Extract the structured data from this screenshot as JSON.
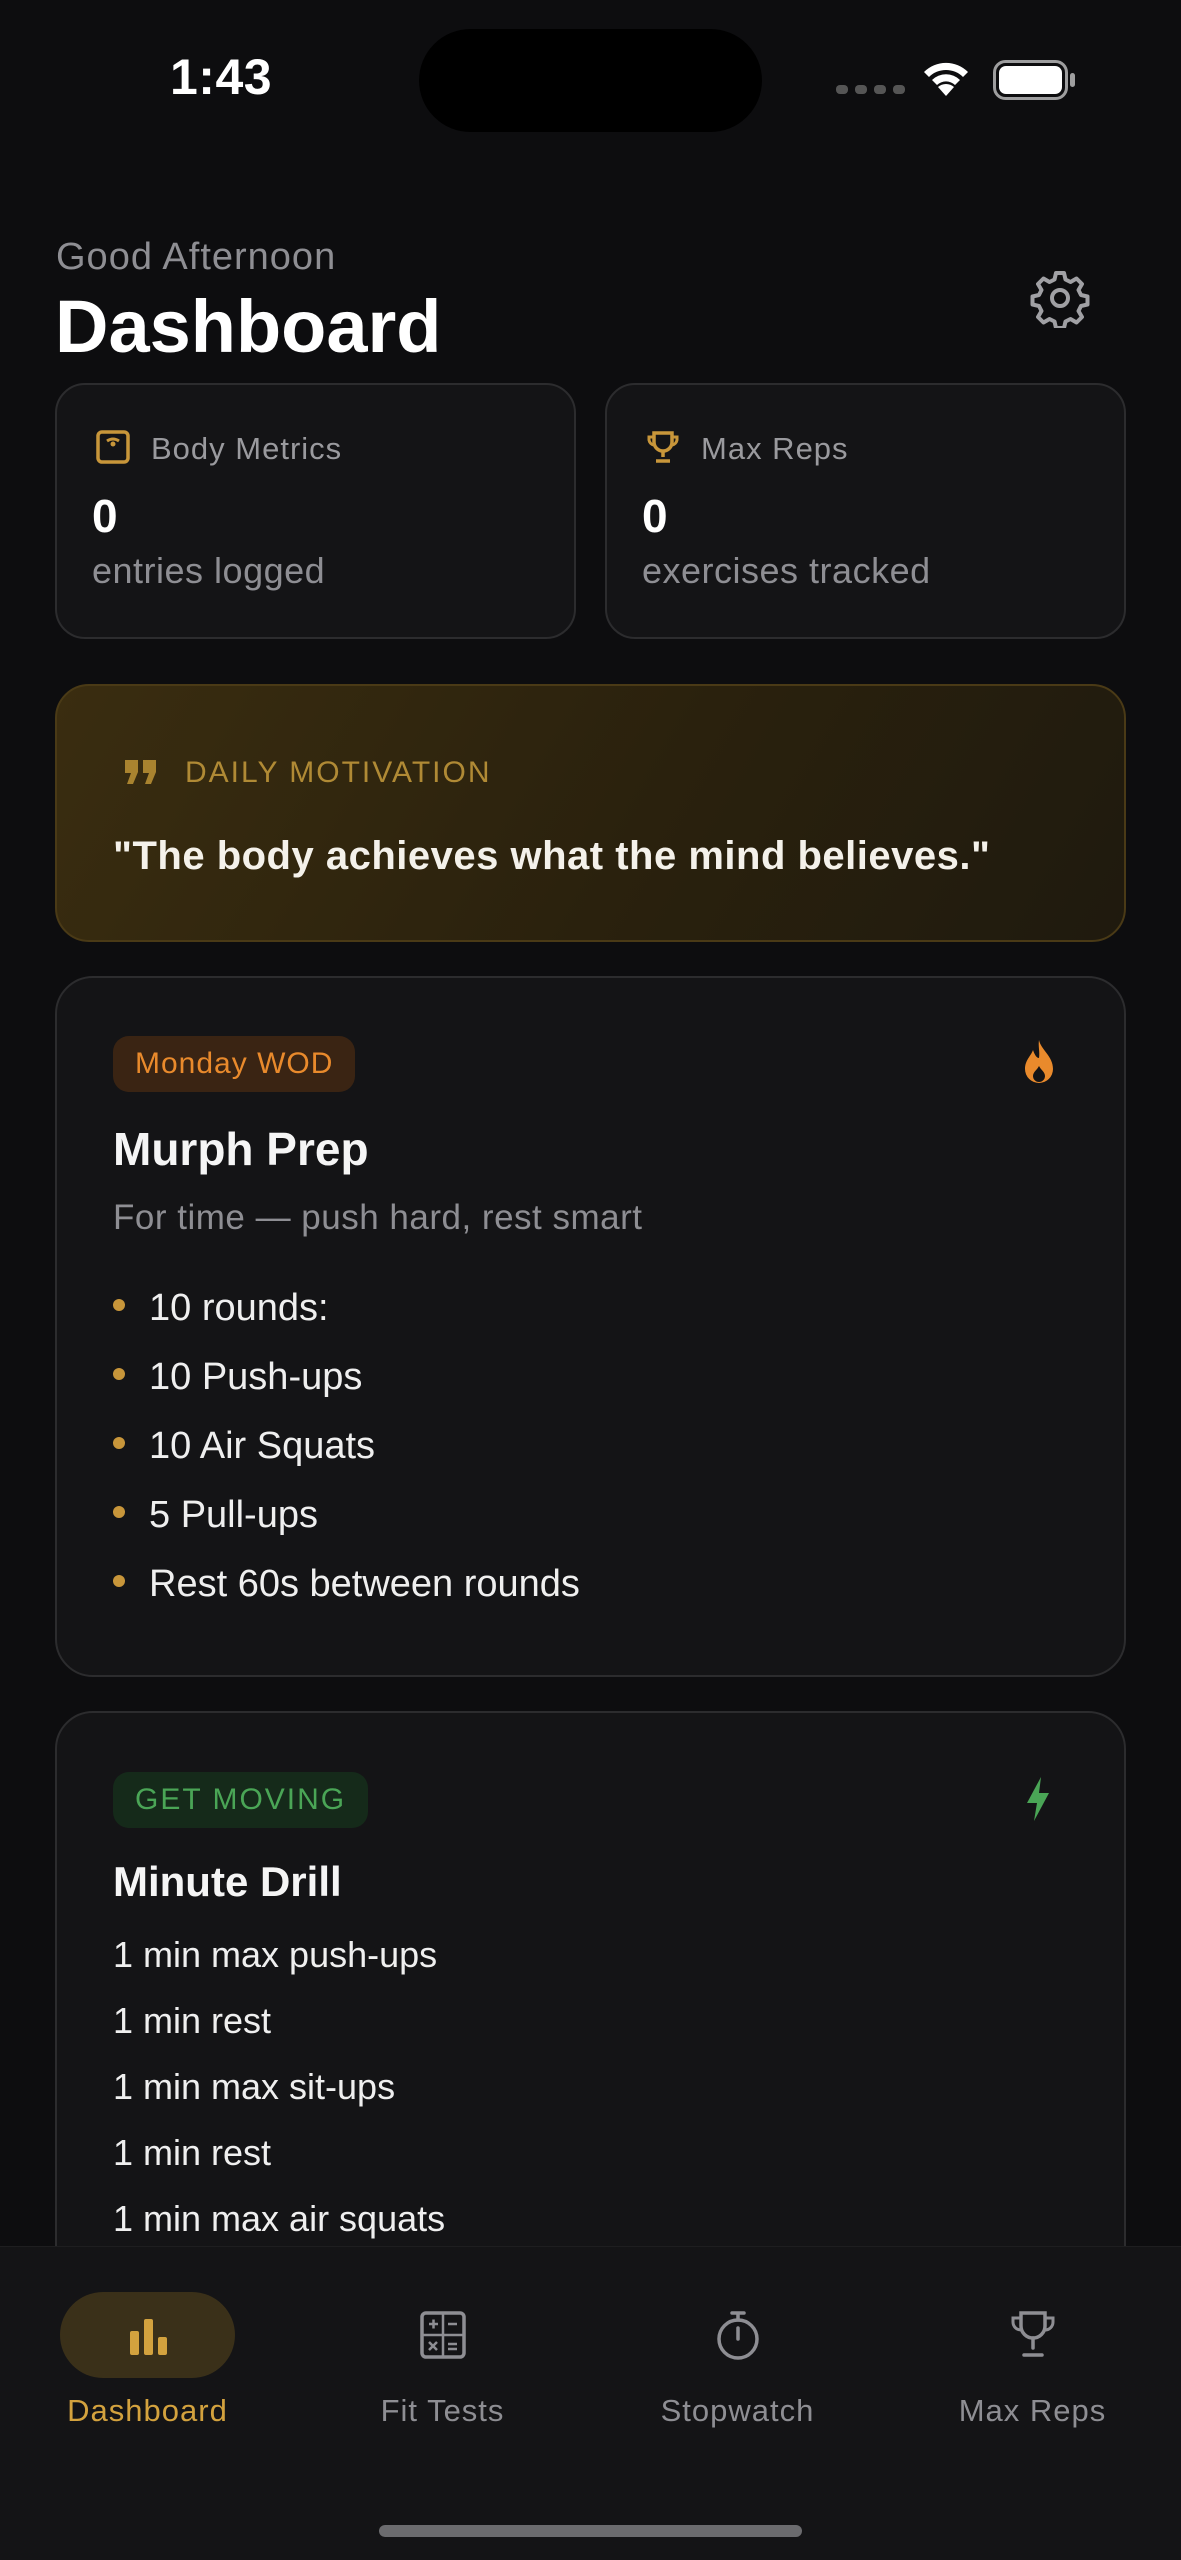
{
  "status_bar": {
    "time": "1:43"
  },
  "header": {
    "greeting": "Good Afternoon",
    "title": "Dashboard",
    "settings_icon": "gear-icon"
  },
  "stats": [
    {
      "icon": "scale-icon",
      "label": "Body Metrics",
      "value": "0",
      "sub": "entries logged"
    },
    {
      "icon": "trophy-icon",
      "label": "Max Reps",
      "value": "0",
      "sub": "exercises tracked"
    }
  ],
  "motivation": {
    "icon": "quote-icon",
    "label": "DAILY MOTIVATION",
    "quote": "\"The body achieves what the mind believes.\""
  },
  "wod": {
    "badge": "Monday WOD",
    "icon": "flame-icon",
    "title": "Murph Prep",
    "subtitle": "For time — push hard, rest smart",
    "items": [
      "10 rounds:",
      "10 Push-ups",
      "10 Air Squats",
      "5 Pull-ups",
      "Rest 60s between rounds"
    ]
  },
  "drill": {
    "badge": "GET MOVING",
    "icon": "bolt-icon",
    "title": "Minute Drill",
    "lines": [
      "1 min max push-ups",
      "1 min rest",
      "1 min max sit-ups",
      "1 min rest",
      "1 min max air squats"
    ]
  },
  "tabs": [
    {
      "label": "Dashboard",
      "icon": "bar-chart-icon",
      "active": true
    },
    {
      "label": "Fit Tests",
      "icon": "calculator-icon",
      "active": false
    },
    {
      "label": "Stopwatch",
      "icon": "stopwatch-icon",
      "active": false
    },
    {
      "label": "Max Reps",
      "icon": "trophy-icon",
      "active": false
    }
  ],
  "colors": {
    "accent_gold": "#d3a23e",
    "wod_orange": "#e98a2c",
    "drill_green": "#4aa556",
    "background": "#0d0d0f",
    "card": "#141416"
  }
}
